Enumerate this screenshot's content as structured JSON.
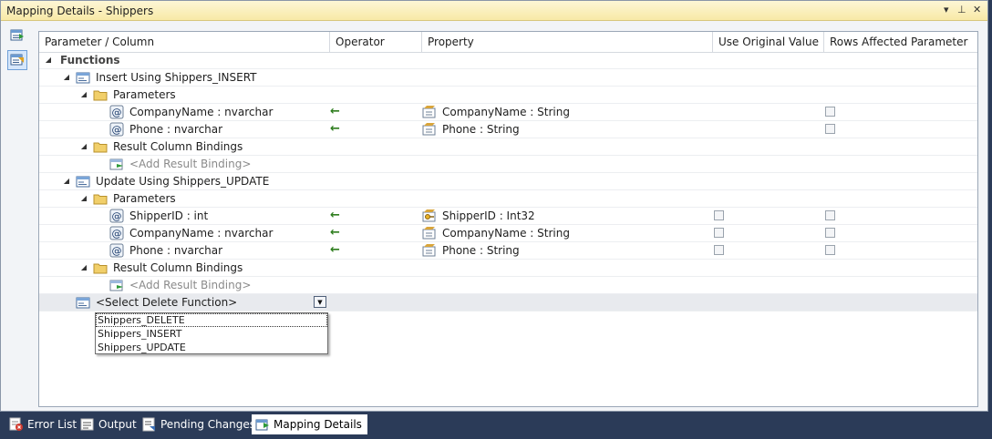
{
  "window": {
    "title": "Mapping Details - Shippers"
  },
  "titlebar": {
    "dropdown_icon": "▾",
    "pin_icon": "⊥",
    "close_icon": "✕"
  },
  "columns": [
    "Parameter / Column",
    "Operator",
    "Property",
    "Use Original Value",
    "Rows Affected Parameter"
  ],
  "tree": {
    "functions_label": "Functions",
    "insert_label": "Insert Using Shippers_INSERT",
    "insert_params_label": "Parameters",
    "insert_params": [
      {
        "param": "CompanyName : nvarchar",
        "operator": "←",
        "property": "CompanyName : String"
      },
      {
        "param": "Phone : nvarchar",
        "operator": "←",
        "property": "Phone : String"
      }
    ],
    "insert_results_label": "Result Column Bindings",
    "insert_add_binding": "<Add Result Binding>",
    "update_label": "Update Using Shippers_UPDATE",
    "update_params_label": "Parameters",
    "update_params": [
      {
        "param": "ShipperID : int",
        "operator": "←",
        "property": "ShipperID : Int32"
      },
      {
        "param": "CompanyName : nvarchar",
        "operator": "←",
        "property": "CompanyName : String"
      },
      {
        "param": "Phone : nvarchar",
        "operator": "←",
        "property": "Phone : String"
      }
    ],
    "update_results_label": "Result Column Bindings",
    "update_add_binding": "<Add Result Binding>",
    "delete_select": "<Select Delete Function>"
  },
  "dropdown": {
    "options": [
      "Shippers_DELETE",
      "Shippers_INSERT",
      "Shippers_UPDATE"
    ]
  },
  "bottom_tabs": [
    "Error List",
    "Output",
    "Pending Changes",
    "Mapping Details"
  ],
  "colors": {
    "title_bg": "#f8e9a6",
    "arrow": "#2e7d1e",
    "tabbar": "#2b3b58"
  }
}
